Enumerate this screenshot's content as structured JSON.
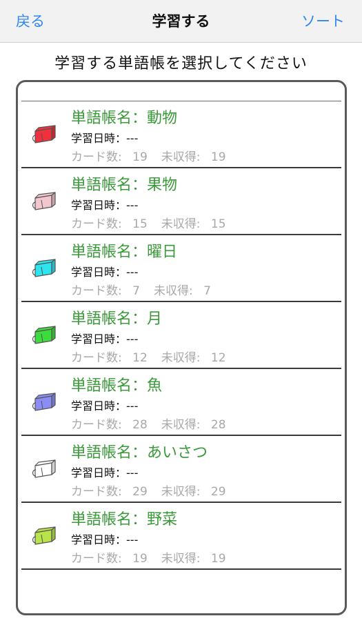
{
  "nav": {
    "back_label": "戻る",
    "title": "学習する",
    "sort_label": "ソート"
  },
  "instruction": "学習する単語帳を選択してください",
  "list": {
    "label_name_prefix": "単語帳名：",
    "label_study_time": "学習日時：",
    "label_cards": "カード数: ",
    "label_unlearned": "未収得: ",
    "items": [
      {
        "name": "動物",
        "study_time": "---",
        "cards": "19",
        "unlearned": "19",
        "color": "#f0303c"
      },
      {
        "name": "果物",
        "study_time": "---",
        "cards": "15",
        "unlearned": "15",
        "color": "#f2c6cf"
      },
      {
        "name": "曜日",
        "study_time": "---",
        "cards": "7",
        "unlearned": "7",
        "color": "#2ee4ee"
      },
      {
        "name": "月",
        "study_time": "---",
        "cards": "12",
        "unlearned": "12",
        "color": "#3cdc3c"
      },
      {
        "name": "魚",
        "study_time": "---",
        "cards": "28",
        "unlearned": "28",
        "color": "#8c8cf5"
      },
      {
        "name": "あいさつ",
        "study_time": "---",
        "cards": "29",
        "unlearned": "29",
        "color": "#ffffff"
      },
      {
        "name": "野菜",
        "study_time": "---",
        "cards": "19",
        "unlearned": "19",
        "color": "#b8e44a"
      }
    ]
  }
}
